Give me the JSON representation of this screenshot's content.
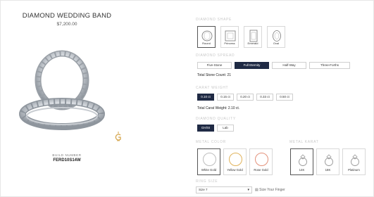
{
  "product": {
    "title": "DIAMOND WEDDING BAND",
    "price": "$7,200.00",
    "build_label": "BUILD NUMBER",
    "build_number": "FERD10S14W"
  },
  "shape": {
    "label": "DIAMOND SHAPE",
    "options": [
      "Round",
      "Princess",
      "Emerald",
      "Oval"
    ],
    "selected": "Round"
  },
  "spread": {
    "label": "DIAMOND SPREAD",
    "options": [
      "Five-Stone",
      "Full Eternity",
      "Half-Way",
      "Three-Forths"
    ],
    "selected": "Full Eternity",
    "total_stone_count": "Total Stone Count: 21"
  },
  "carat": {
    "label": "CARAT WEIGHT",
    "options": [
      "0.10 ct",
      "0.15 ct",
      "0.20 ct",
      "0.33 ct",
      "0.50 ct"
    ],
    "selected": "0.10 ct",
    "total_weight": "Total Carat Weight: 2.10 ct."
  },
  "quality": {
    "label": "DIAMOND QUALITY",
    "options": [
      "GH/SI",
      "Lab"
    ],
    "selected": "GH/SI"
  },
  "metal_color": {
    "label": "METAL COLOR",
    "options": [
      "White Gold",
      "Yellow Gold",
      "Rose Gold"
    ],
    "selected": "White Gold"
  },
  "metal_karat": {
    "label": "METAL KARAT",
    "options": [
      "14K",
      "18K",
      "Platinum"
    ],
    "selected": "14K"
  },
  "ring_size": {
    "label": "RING SIZE",
    "value": "Size 7",
    "size_link": "Size Your Finger"
  },
  "colors": {
    "accent_navy": "#1f2a44",
    "white_gold": "#bdbdbd",
    "yellow_gold": "#e0b25a",
    "rose_gold": "#e3917a",
    "logo_gold": "#d4a44a"
  }
}
